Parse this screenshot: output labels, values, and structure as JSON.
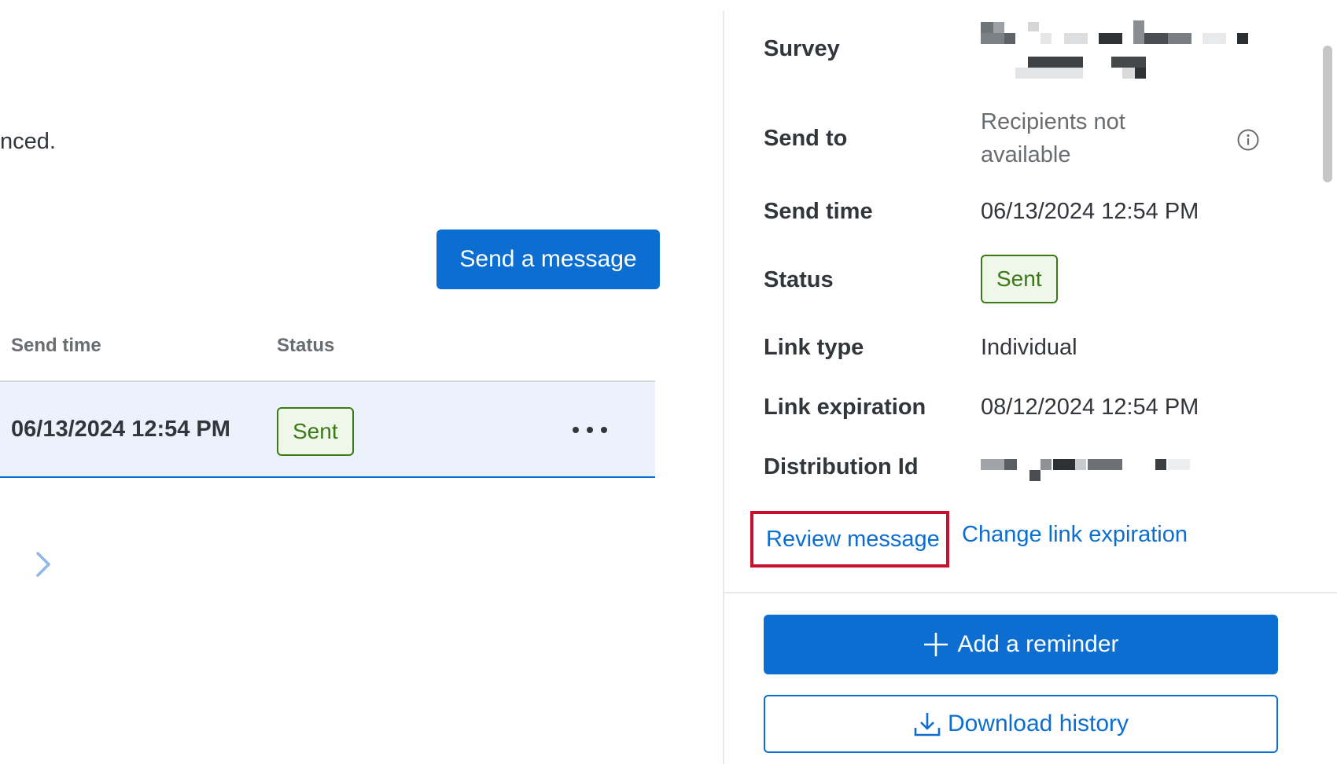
{
  "left": {
    "intro_text": "nced.",
    "send_button_label": "Send a message",
    "table": {
      "headers": [
        "Send time",
        "Status"
      ],
      "rows": [
        {
          "send_time": "06/13/2024 12:54 PM",
          "status": "Sent"
        }
      ]
    },
    "icons": {
      "row_menu": "more-horizontal-icon",
      "next_page": "chevron-right-icon"
    }
  },
  "details": {
    "survey_label": "Survey",
    "send_to_label": "Send to",
    "send_to_value": "Recipients not available",
    "send_time_label": "Send time",
    "send_time_value": "06/13/2024 12:54 PM",
    "status_label": "Status",
    "status_value": "Sent",
    "link_type_label": "Link type",
    "link_type_value": "Individual",
    "link_expiration_label": "Link expiration",
    "link_expiration_value": "08/12/2024 12:54 PM",
    "distribution_id_label": "Distribution Id",
    "review_link": "Review message",
    "change_link": "Change link expiration"
  },
  "actions": {
    "reminder_label": "Add a reminder",
    "download_label": "Download history"
  },
  "colors": {
    "primary": "#0b6ed0",
    "success_text": "#3b7a17",
    "success_bg": "#eef7ea",
    "row_highlight": "#ebf2fb",
    "highlight_box": "#c8102e"
  }
}
